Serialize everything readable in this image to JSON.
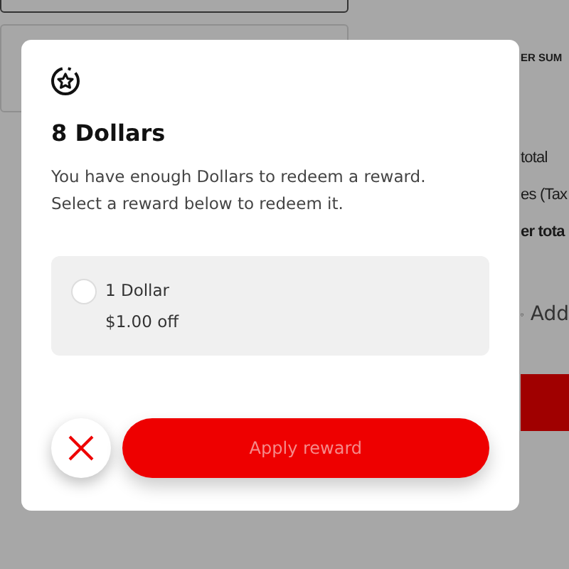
{
  "background": {
    "summary_heading": "ER SUM",
    "lines": [
      "total",
      "es (Tax",
      "er tota"
    ],
    "add_link": "Add"
  },
  "dialog": {
    "title": "8 Dollars",
    "message": "You have enough Dollars to redeem a reward. Select a reward below to redeem it.",
    "rewards": [
      {
        "name": "1 Dollar",
        "detail": "$1.00 off",
        "selected": false
      }
    ],
    "apply_button": {
      "label": "Apply reward",
      "disabled": true
    }
  }
}
